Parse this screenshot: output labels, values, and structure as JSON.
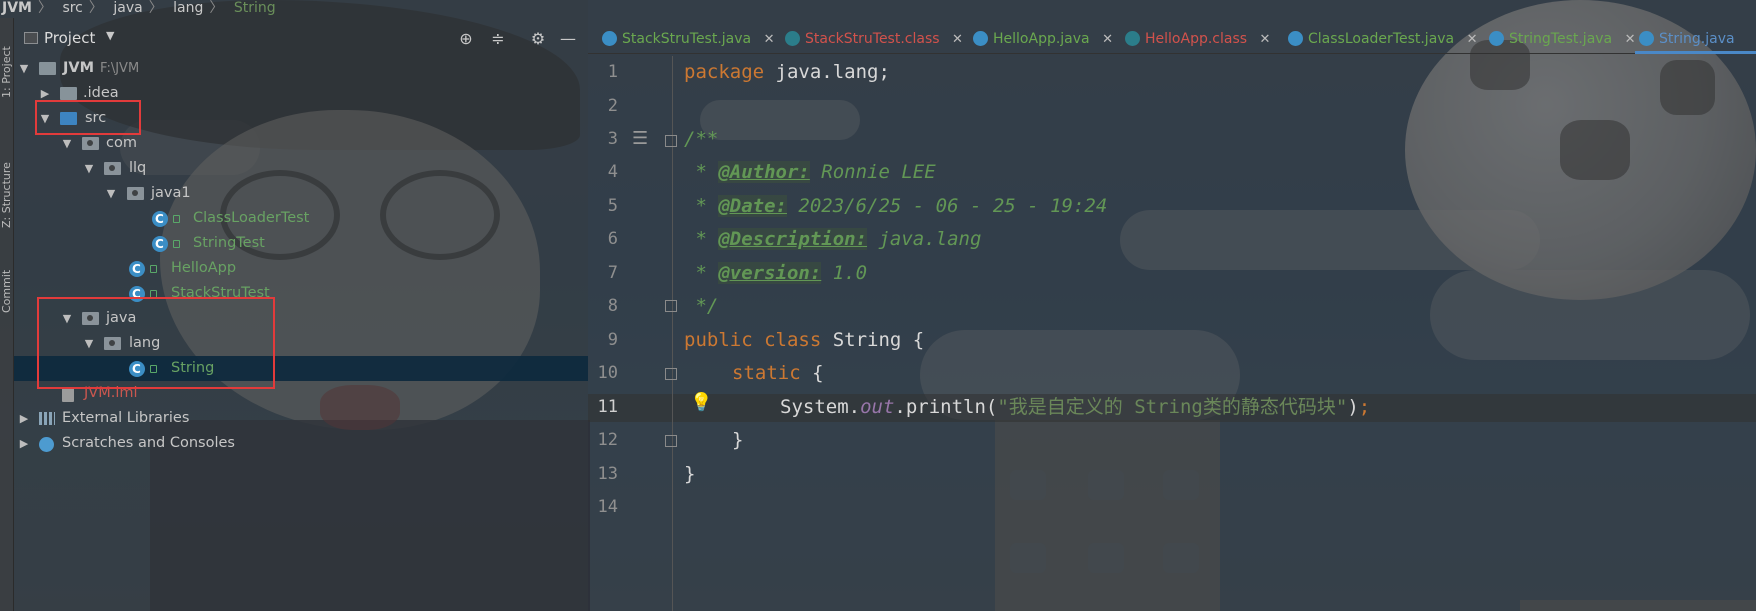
{
  "breadcrumb": {
    "items": [
      "JVM",
      "src",
      "java",
      "lang"
    ],
    "file": "String"
  },
  "toolstrip": {
    "project_tab": "1: Project",
    "structure_tab": "Z: Structure",
    "commit_tab": "Commit"
  },
  "project_panel": {
    "title": "Project",
    "icons": [
      "locate-icon",
      "collapse-icon",
      "gear-icon",
      "minimize-icon"
    ]
  },
  "tree": [
    {
      "label": "JVM",
      "suffix": "F:\\JVM",
      "kind": "module",
      "expanded": true
    },
    {
      "label": ".idea",
      "kind": "folder",
      "expanded": false
    },
    {
      "label": "src",
      "kind": "source-folder",
      "expanded": true
    },
    {
      "label": "com",
      "kind": "package",
      "expanded": true
    },
    {
      "label": "llq",
      "kind": "package",
      "expanded": true
    },
    {
      "label": "java1",
      "kind": "package",
      "expanded": true
    },
    {
      "label": "ClassLoaderTest",
      "kind": "class"
    },
    {
      "label": "StringTest",
      "kind": "class"
    },
    {
      "label": "HelloApp",
      "kind": "class"
    },
    {
      "label": "StackStruTest",
      "kind": "class"
    },
    {
      "label": "java",
      "kind": "package",
      "expanded": true
    },
    {
      "label": "lang",
      "kind": "package",
      "expanded": true
    },
    {
      "label": "String",
      "kind": "class",
      "selected": true
    },
    {
      "label": "JVM.iml",
      "kind": "iml"
    },
    {
      "label": "External Libraries",
      "kind": "libraries",
      "expanded": false
    },
    {
      "label": "Scratches and Consoles",
      "kind": "scratches",
      "expanded": false
    }
  ],
  "tabs": [
    {
      "label": "StackStruTest.java",
      "color": "green"
    },
    {
      "label": "StackStruTest.class",
      "color": "red"
    },
    {
      "label": "HelloApp.java",
      "color": "green"
    },
    {
      "label": "HelloApp.class",
      "color": "red"
    },
    {
      "label": "ClassLoaderTest.java",
      "color": "green"
    },
    {
      "label": "StringTest.java",
      "color": "green"
    },
    {
      "label": "String.java",
      "color": "blue",
      "active": true
    }
  ],
  "editor": {
    "line_numbers": [
      "1",
      "2",
      "3",
      "4",
      "5",
      "6",
      "7",
      "8",
      "9",
      "10",
      "11",
      "12",
      "13",
      "14"
    ],
    "current_line": "11",
    "code": {
      "l1_kw": "package",
      "l1_rest": " java.lang;",
      "l3": "/**",
      "l4_pre": " * ",
      "l4_tag": "@Author:",
      "l4_val": " Ronnie LEE",
      "l5_pre": " * ",
      "l5_tag": "@Date:",
      "l5_val": " 2023/6/25 - 06 - 25 - 19:24",
      "l6_pre": " * ",
      "l6_tag": "@Description:",
      "l6_val": " java.lang",
      "l7_pre": " * ",
      "l7_tag": "@version:",
      "l7_val": " 1.0",
      "l8": " */",
      "l9_kw": "public class",
      "l9_rest": " String {",
      "l10_kw": "static",
      "l10_rest": " {",
      "l11_a": "System.",
      "l11_field": "out",
      "l11_b": ".println(",
      "l11_str": "\"我是自定义的 String类的静态代码块\"",
      "l11_c": ")",
      "l11_semi": ";",
      "l12": "}",
      "l13": "}"
    }
  },
  "colors": {
    "keyword": "#cc7832",
    "comment": "#629755",
    "string": "#6a8759",
    "annotation_box": "#e23b3b",
    "selection": "#0d293e"
  }
}
